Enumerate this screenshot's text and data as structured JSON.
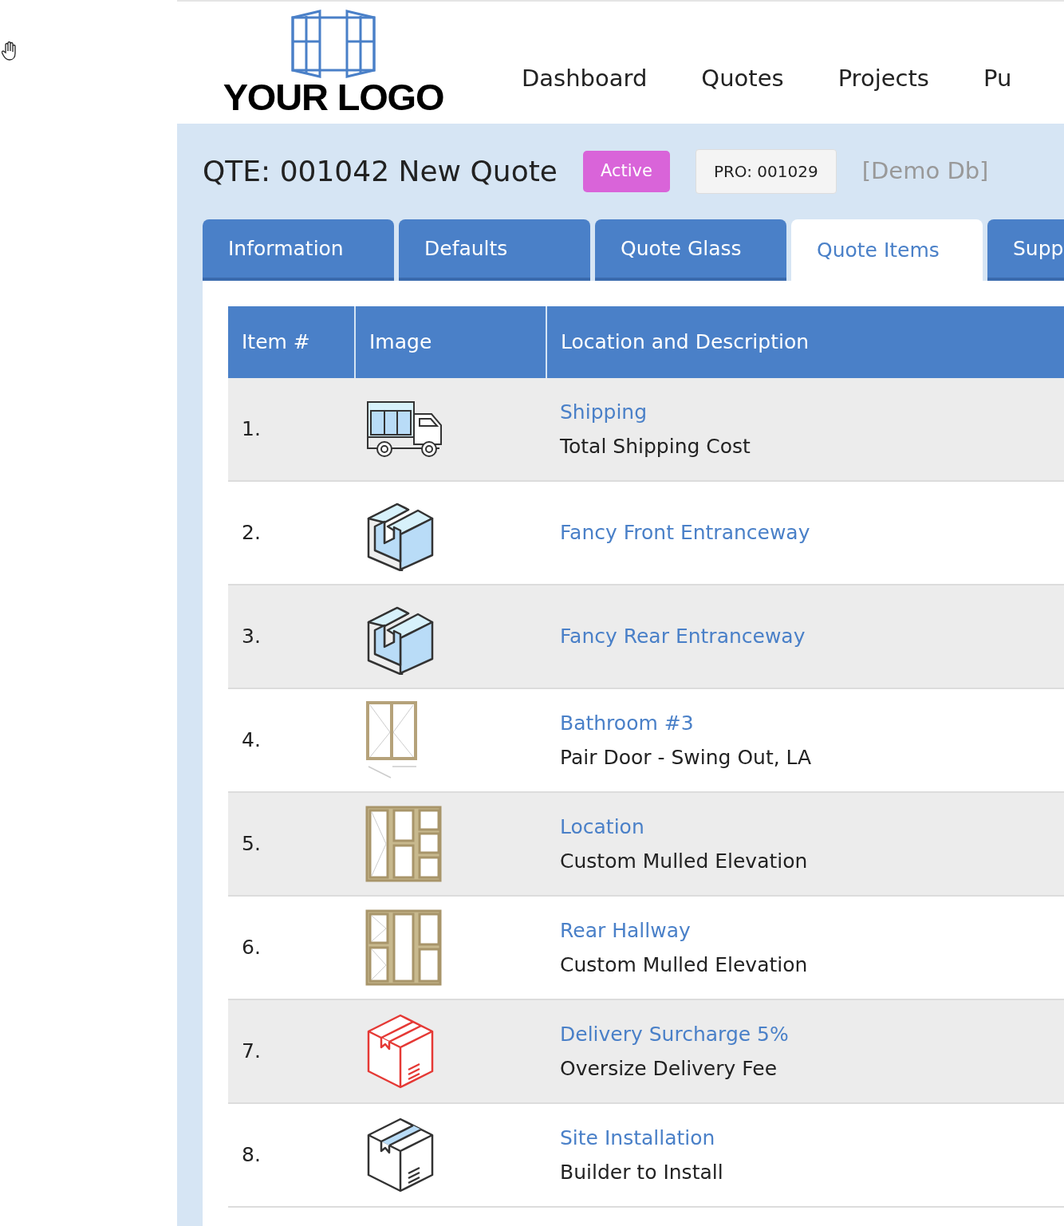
{
  "header": {
    "logo_text": "YOUR LOGO",
    "nav": [
      {
        "label": "Dashboard"
      },
      {
        "label": "Quotes"
      },
      {
        "label": "Projects"
      },
      {
        "label": "Pu"
      }
    ]
  },
  "quote": {
    "title": "QTE: 001042 New Quote",
    "status": "Active",
    "project": "PRO: 001029",
    "database": "[Demo Db]"
  },
  "tabs": [
    {
      "label": "Information",
      "selected": false
    },
    {
      "label": "Defaults",
      "selected": false
    },
    {
      "label": "Quote Glass",
      "selected": false
    },
    {
      "label": "Quote Items",
      "selected": true
    },
    {
      "label": "Supp",
      "selected": false
    }
  ],
  "table": {
    "columns": [
      "Item #",
      "Image",
      "Location and Description"
    ],
    "rows": [
      {
        "number": "1.",
        "kind": "truck",
        "title": "Shipping",
        "description": "Total Shipping Cost"
      },
      {
        "number": "2.",
        "kind": "bay",
        "title": "Fancy Front Entranceway"
      },
      {
        "number": "3.",
        "kind": "bay",
        "title": "Fancy Rear Entranceway"
      },
      {
        "number": "4.",
        "kind": "door",
        "title": "Bathroom #3",
        "description": "Pair Door - Swing Out, LA"
      },
      {
        "number": "5.",
        "kind": "elevation_a",
        "title": "Location",
        "description": "Custom Mulled Elevation"
      },
      {
        "number": "6.",
        "kind": "elevation_b",
        "title": "Rear Hallway",
        "description": "Custom Mulled Elevation"
      },
      {
        "number": "7.",
        "kind": "box_red",
        "title": "Delivery Surcharge 5%",
        "description": "Oversize Delivery Fee"
      },
      {
        "number": "8.",
        "kind": "box",
        "title": "Site Installation",
        "description": "Builder to Install"
      }
    ]
  }
}
